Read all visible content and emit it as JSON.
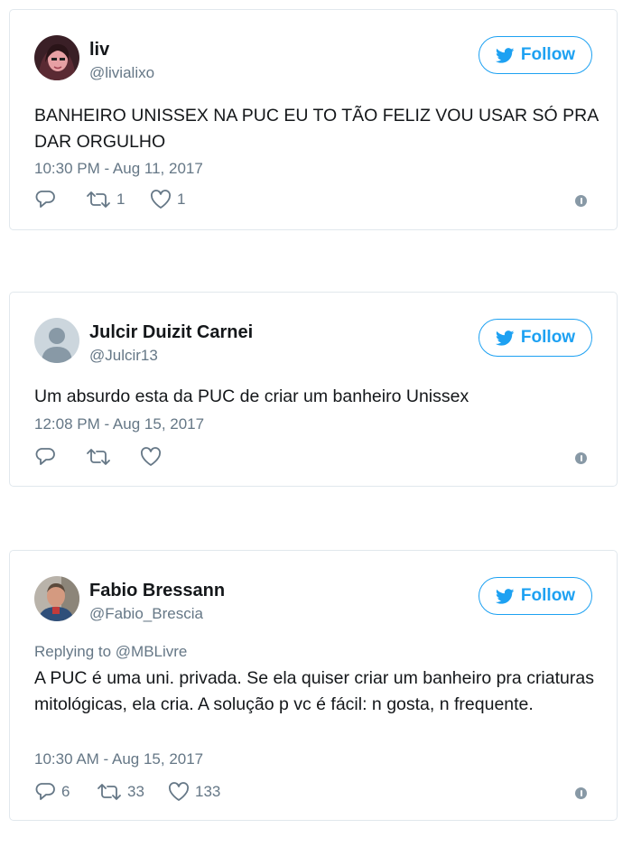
{
  "follow_label": "Follow",
  "colors": {
    "accent": "#1da1f2",
    "secondary_text": "#657786",
    "border": "#e1e8ed"
  },
  "tweets": [
    {
      "name": "liv",
      "handle": "@livialixo",
      "text": "BANHEIRO UNISSEX NA PUC EU TO TÃO FELIZ VOU USAR SÓ PRA DAR ORGULHO",
      "timestamp": "10:30 PM - Aug 11, 2017",
      "replies": "",
      "retweets": "1",
      "likes": "1",
      "avatar": "photo"
    },
    {
      "name": "Julcir Duizit Carnei",
      "handle": "@Julcir13",
      "text": "Um absurdo esta da PUC de criar um banheiro Unissex",
      "timestamp": "12:08 PM - Aug 15, 2017",
      "replies": "",
      "retweets": "",
      "likes": "",
      "avatar": "default-silhouette"
    },
    {
      "name": "Fabio Bressann",
      "handle": "@Fabio_Brescia",
      "replying_to": "Replying to @MBLivre",
      "text": "A PUC é uma uni. privada. Se ela quiser criar um banheiro pra criaturas mitológicas, ela cria. A solução p vc é fácil: n gosta, n frequente.",
      "timestamp": "10:30 AM - Aug 15, 2017",
      "replies": "6",
      "retweets": "33",
      "likes": "133",
      "avatar": "photo"
    }
  ]
}
